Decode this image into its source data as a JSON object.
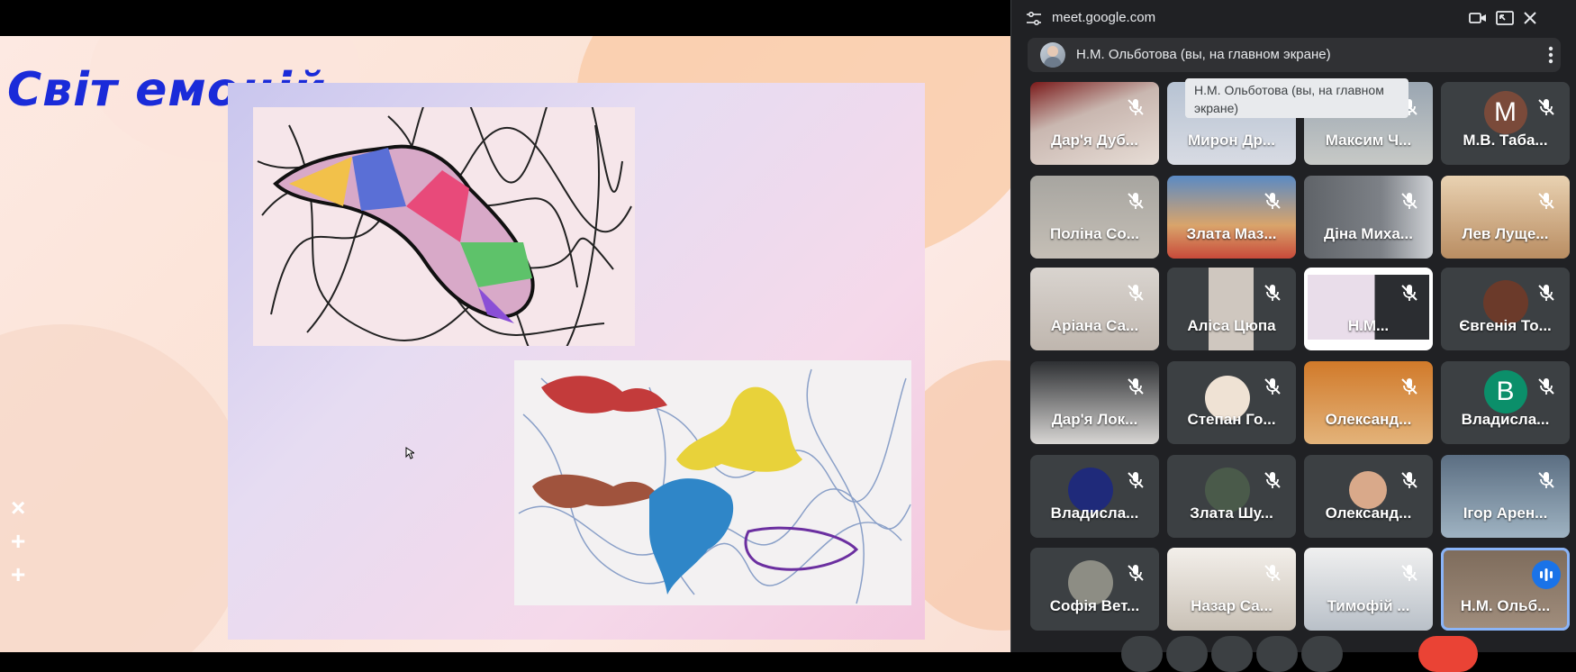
{
  "slide": {
    "title": "Світ емоцій",
    "deco": [
      "×",
      "+",
      "+"
    ]
  },
  "meet": {
    "url": "meet.google.com",
    "presenter": "Н.М. Ольботова (вы, на главном экране)",
    "tooltip": "Н.М. Ольботова (вы, на главном экране)",
    "participants": [
      {
        "name": "Дар'я Дуб..."
      },
      {
        "name": "Мирон Др..."
      },
      {
        "name": "Максим Ч..."
      },
      {
        "name": "М.В. Таба...",
        "letter": "M"
      },
      {
        "name": "Поліна Со..."
      },
      {
        "name": "Злата Маз..."
      },
      {
        "name": "Діна Миха..."
      },
      {
        "name": "Лев Луще..."
      },
      {
        "name": "Аріана Са..."
      },
      {
        "name": "Аліса Цюпа"
      },
      {
        "name": "Н.М..."
      },
      {
        "name": "Євгенія То..."
      },
      {
        "name": "Дар'я Лок..."
      },
      {
        "name": "Степан Го..."
      },
      {
        "name": "Олександ..."
      },
      {
        "name": "Владисла...",
        "letter": "B"
      },
      {
        "name": "Владисла..."
      },
      {
        "name": "Злата Шу..."
      },
      {
        "name": "Олександ..."
      },
      {
        "name": "Ігор Арен..."
      },
      {
        "name": "Софія Вет..."
      },
      {
        "name": "Назар Са..."
      },
      {
        "name": "Тимофій ..."
      },
      {
        "name": "Н.М. Ольб..."
      }
    ]
  },
  "colors": {
    "title_blue": "#1a2bd9",
    "panel_bg": "#202124",
    "tile_bg": "#3c4043",
    "active_outline": "#8ab4f8",
    "end_call": "#ea4335"
  },
  "icons": [
    "tune-icon",
    "camera-icon",
    "pip-icon",
    "close-icon",
    "more-vert-icon",
    "mic-off-icon",
    "speaking-icon"
  ]
}
